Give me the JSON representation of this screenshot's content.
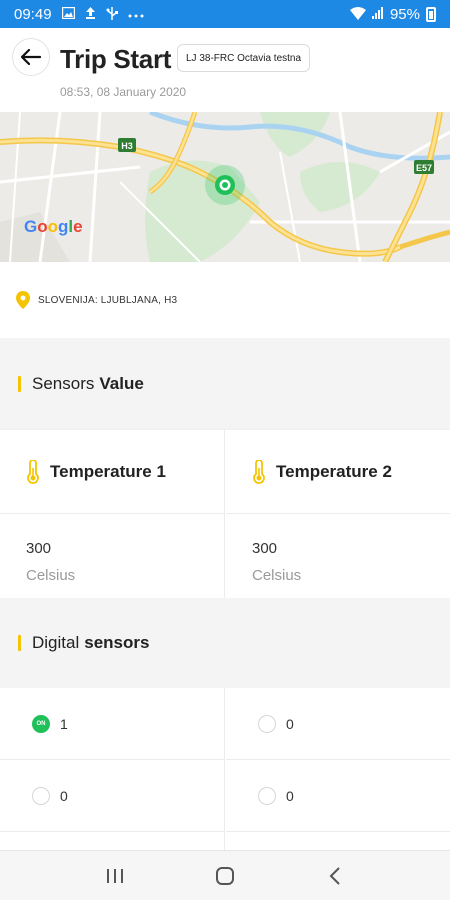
{
  "status_bar": {
    "time": "09:49",
    "battery": "95%",
    "icons": [
      "image-icon",
      "upload-icon",
      "usb-icon",
      "more-icon",
      "wifi-icon",
      "signal-icon",
      "battery-icon"
    ]
  },
  "header": {
    "title": "Trip Start",
    "vehicle": "LJ 38-FRC Octavia testna",
    "datetime": "08:53, 08 January 2020"
  },
  "map": {
    "provider_logo": "Google",
    "road_labels": [
      "H3",
      "E57"
    ],
    "marker_icon": "location-target-icon"
  },
  "location": {
    "icon": "map-pin-icon",
    "text": "SLOVENIJA: LJUBLJANA, H3"
  },
  "sensors_section": {
    "label_regular": "Sensors",
    "label_bold": "Value"
  },
  "sensors": [
    {
      "name": "Temperature 1",
      "value": "300",
      "unit": "Celsius",
      "icon": "thermometer-icon"
    },
    {
      "name": "Temperature 2",
      "value": "300",
      "unit": "Celsius",
      "icon": "thermometer-icon"
    }
  ],
  "digital_section": {
    "label_regular": "Digital",
    "label_bold": "sensors"
  },
  "digital_sensors": [
    {
      "value": "1",
      "state": "on",
      "badge": "ON"
    },
    {
      "value": "0",
      "state": "off"
    },
    {
      "value": "0",
      "state": "off"
    },
    {
      "value": "0",
      "state": "off"
    }
  ],
  "colors": {
    "status_bar": "#1e88e5",
    "accent_yellow": "#f5c400",
    "on_green": "#1fbf5a",
    "marker_green": "#1fbf5a"
  },
  "nav_bar": {
    "buttons": [
      "recent-apps-icon",
      "home-icon",
      "back-icon"
    ]
  }
}
